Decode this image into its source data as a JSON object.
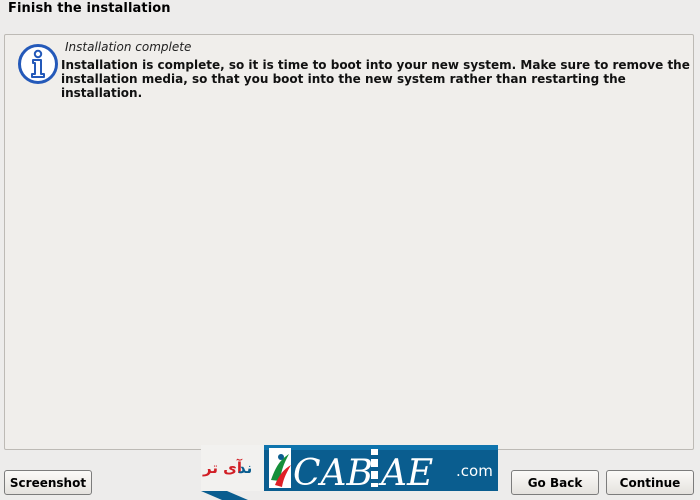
{
  "page": {
    "title": "Finish the installation"
  },
  "message": {
    "icon": "info-icon",
    "heading": "Installation complete",
    "body": "Installation is complete, so it is time to boot into your new system. Make sure to remove the installation media, so that you boot into the new system rather than restarting the installation."
  },
  "buttons": {
    "screenshot": "Screenshot",
    "go_back": "Go Back",
    "continue": "Continue"
  },
  "watermark": {
    "text": "آی تی ترند .com"
  },
  "colors": {
    "info_icon": "#2459b9",
    "background": "#edeceb",
    "watermark_dark": "#0a5d8f"
  }
}
